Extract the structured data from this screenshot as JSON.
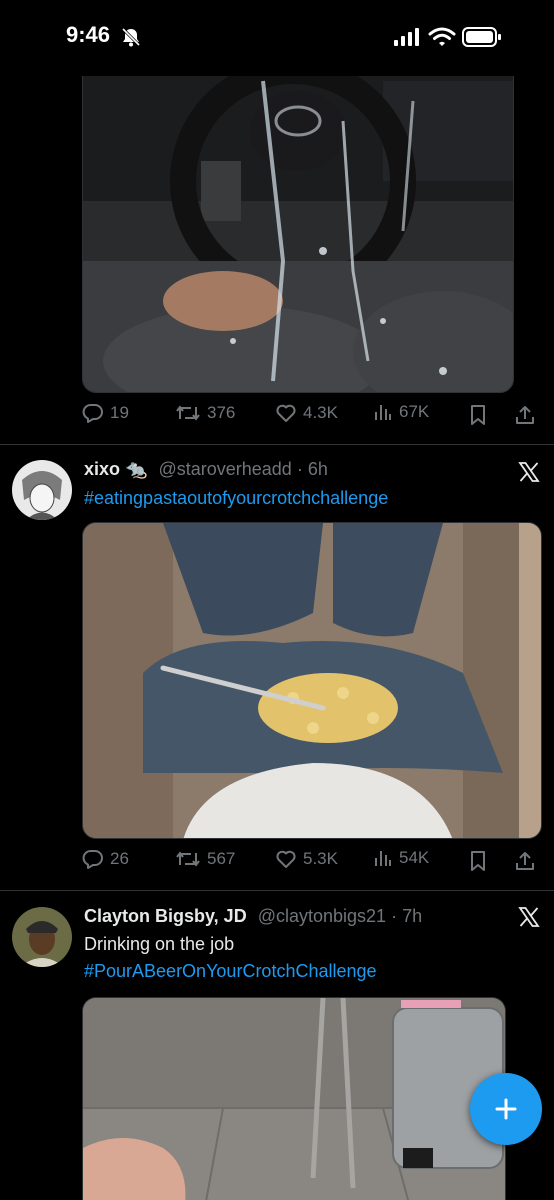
{
  "status_bar": {
    "time": "9:46",
    "icons": [
      "bell-slash-icon",
      "cellular-signal-icon",
      "wifi-icon",
      "battery-icon"
    ]
  },
  "tweets": [
    {
      "image": "steering-wheel-liquid-photo",
      "stats": {
        "replies": "19",
        "reposts": "376",
        "likes": "4.3K",
        "views": "67K"
      }
    },
    {
      "display_name": "xixo 🐀",
      "handle": "@staroverheadd",
      "time": "· 6h",
      "hashtag": "#eatingpastaoutofyourcrotchchallenge",
      "image": "pasta-on-lap-photo",
      "stats": {
        "replies": "26",
        "reposts": "567",
        "likes": "5.3K",
        "views": "54K"
      }
    },
    {
      "display_name": "Clayton Bigsby, JD",
      "handle": "@claytonbigs21",
      "time": "· 7h",
      "text": "Drinking on the job",
      "hashtag": "#PourABeerOnYourCrotchChallenge",
      "image": "kitchen-floor-photo"
    }
  ],
  "fab": {
    "icon": "plus-icon"
  },
  "colors": {
    "accent": "#1d9bf0",
    "muted": "#71767b",
    "text": "#e7e9ea",
    "background": "#000000"
  }
}
